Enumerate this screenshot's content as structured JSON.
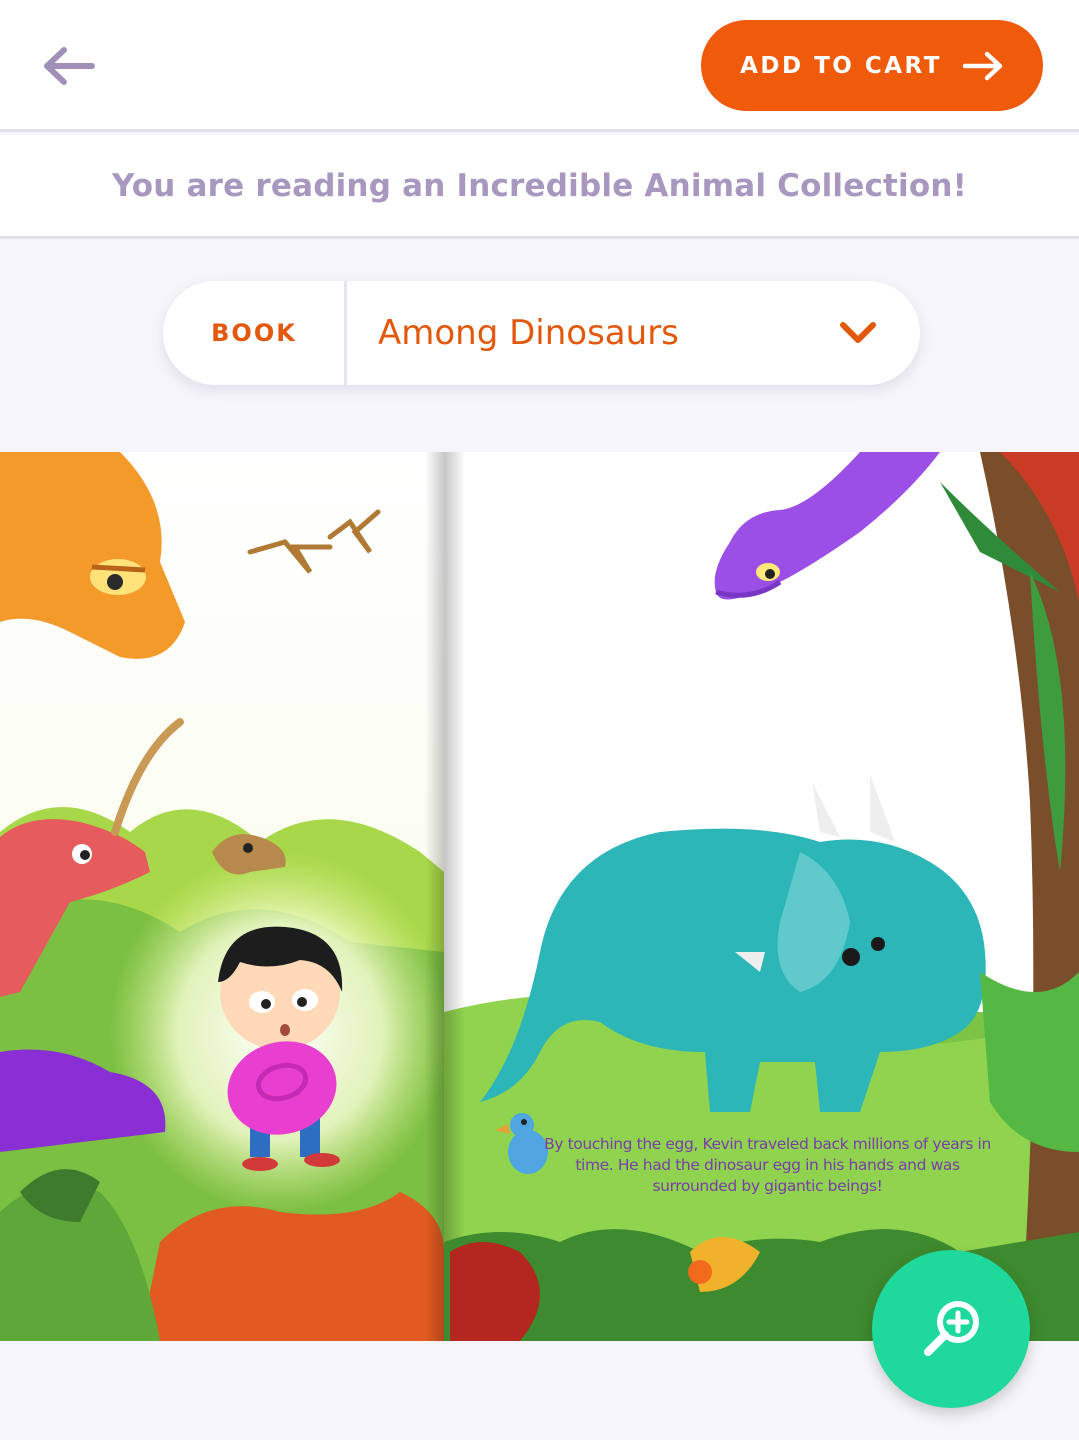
{
  "header": {
    "back_icon": "arrow-left-icon",
    "cart_label": "ADD TO CART",
    "cart_icon": "arrow-right-icon",
    "accent_color": "#ef5a0b"
  },
  "banner": {
    "text": "You are reading an Incredible Animal Collection!"
  },
  "book_selector": {
    "label": "BOOK",
    "selected": "Among Dinosaurs",
    "dropdown_icon": "chevron-down-icon"
  },
  "book_page": {
    "illustration": "storybook-spread-dinosaurs",
    "story_text": "By touching the egg, Kevin traveled back millions of years in time. He had the dinosaur egg in his hands and was surrounded by gigantic beings!"
  },
  "zoom": {
    "icon": "zoom-in-icon",
    "color": "#1fd89b"
  }
}
